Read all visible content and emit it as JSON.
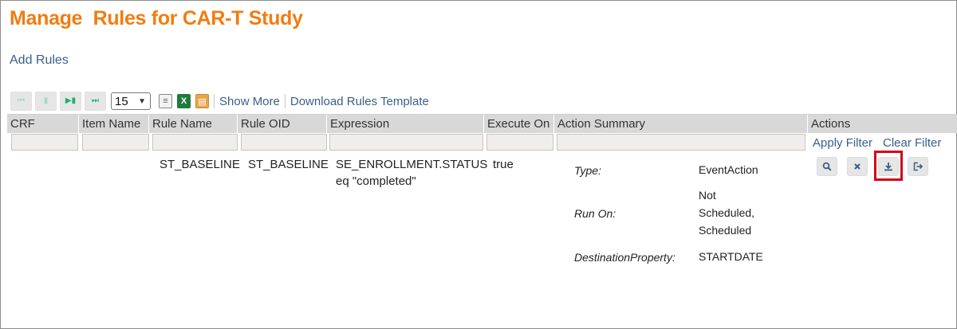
{
  "page": {
    "title": "Manage  Rules for CAR-T Study",
    "add_rules": "Add Rules"
  },
  "toolbar": {
    "first_page": "first-page",
    "prev_page": "previous-page",
    "next_page": "next-page",
    "last_page": "last-page",
    "page_size": "15",
    "show_more": "Show More",
    "download_template": "Download Rules Template"
  },
  "table": {
    "columns": [
      "CRF",
      "Item Name",
      "Rule Name",
      "Rule OID",
      "Expression",
      "Execute On",
      "Action Summary",
      "Actions"
    ],
    "filter_actions": {
      "apply": "Apply Filter",
      "clear": "Clear Filter"
    },
    "rows": [
      {
        "crf": "",
        "item_name": "",
        "rule_name": "ST_BASELINE",
        "rule_oid": "ST_BASELINE",
        "expression_line1": "SE_ENROLLMENT.STATUS",
        "expression_line2": "eq \"completed\"",
        "execute_on": "true",
        "action_summary": {
          "type_label": "Type:",
          "type_value": "EventAction",
          "run_on_label": "Run On:",
          "run_on_line1": "Not",
          "run_on_line2": "Scheduled,",
          "run_on_line3": "Scheduled",
          "dest_label": "DestinationProperty:",
          "dest_value": "STARTDATE"
        },
        "actions": [
          "view-icon",
          "remove-icon",
          "download-icon",
          "export-icon"
        ]
      }
    ]
  },
  "colors": {
    "title": "#f07d10",
    "link": "#3a5f8a",
    "header_bg": "#d8d8d8",
    "highlight": "#d0021b",
    "nav_active": "#14b46e"
  }
}
